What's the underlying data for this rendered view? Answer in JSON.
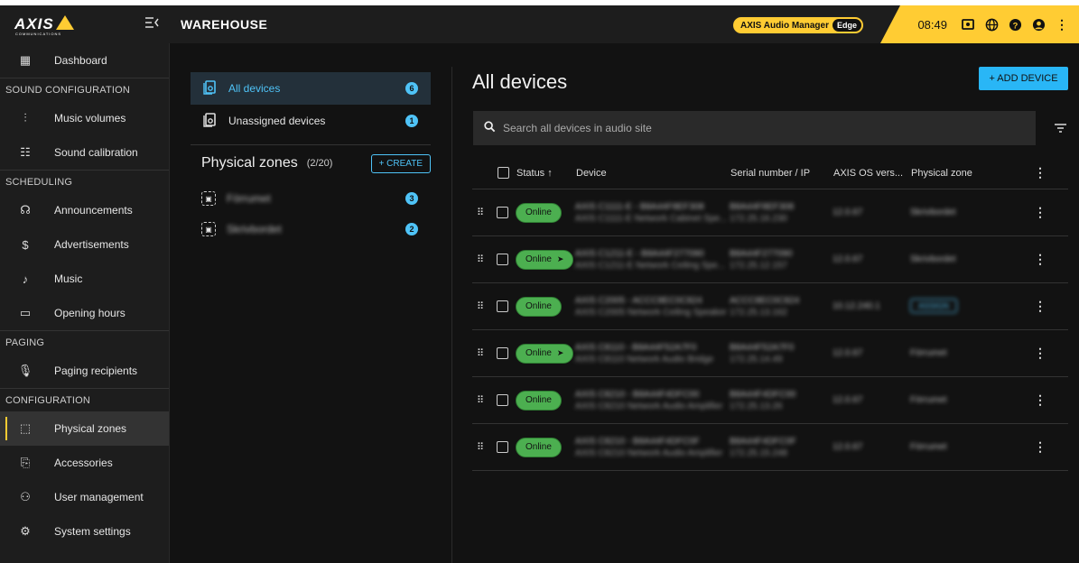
{
  "header": {
    "logo": "AXIS",
    "logo_sub": "COMMUNICATIONS",
    "site_title": "WAREHOUSE",
    "product_badge": "AXIS Audio Manager",
    "edition_badge": "Edge",
    "clock": "08:49"
  },
  "sidebar": {
    "items": [
      {
        "type": "item",
        "label": "Dashboard",
        "icon": "dashboard-icon"
      },
      {
        "type": "section",
        "label": "SOUND CONFIGURATION"
      },
      {
        "type": "item",
        "label": "Music volumes",
        "icon": "sliders-icon"
      },
      {
        "type": "item",
        "label": "Sound calibration",
        "icon": "calibration-icon"
      },
      {
        "type": "section",
        "label": "SCHEDULING"
      },
      {
        "type": "item",
        "label": "Announcements",
        "icon": "announcement-icon"
      },
      {
        "type": "item",
        "label": "Advertisements",
        "icon": "dollar-icon"
      },
      {
        "type": "item",
        "label": "Music",
        "icon": "music-note-icon"
      },
      {
        "type": "item",
        "label": "Opening hours",
        "icon": "calendar-icon"
      },
      {
        "type": "section",
        "label": "PAGING"
      },
      {
        "type": "item",
        "label": "Paging recipients",
        "icon": "microphone-icon"
      },
      {
        "type": "section",
        "label": "CONFIGURATION"
      },
      {
        "type": "item",
        "label": "Physical zones",
        "icon": "zone-icon",
        "active": true
      },
      {
        "type": "item",
        "label": "Accessories",
        "icon": "accessories-icon"
      },
      {
        "type": "item",
        "label": "User management",
        "icon": "users-icon"
      },
      {
        "type": "item",
        "label": "System settings",
        "icon": "gear-icon"
      }
    ]
  },
  "device_groups": [
    {
      "label": "All devices",
      "count": "6"
    },
    {
      "label": "Unassigned devices",
      "count": "1"
    }
  ],
  "zones": {
    "title": "Physical zones",
    "count": "(2/20)",
    "create_label": "+ CREATE",
    "items": [
      {
        "label": "Förrumet",
        "count": "3"
      },
      {
        "label": "Skrivbordet",
        "count": "2"
      }
    ]
  },
  "main": {
    "title": "All devices",
    "add_label": "+ ADD DEVICE",
    "search_placeholder": "Search all devices in audio site",
    "columns": {
      "status": "Status ↑",
      "device": "Device",
      "serial": "Serial number / IP",
      "os": "AXIS OS vers...",
      "zone": "Physical zone"
    },
    "rows": [
      {
        "status": "Online",
        "arrow": false,
        "device": "AXIS C1111-E - B8A44F8EF308",
        "model": "AXIS C1111-E Network Cabinet Spe...",
        "serial": "B8A44F8EF308",
        "ip": "172.25.16.230",
        "os": "12.0.67",
        "zone": "Skrivbordet",
        "zone_chip": false
      },
      {
        "status": "Online",
        "arrow": true,
        "device": "AXIS C1211-E - B8A44F277090",
        "model": "AXIS C1211-E Network Ceiling Spe...",
        "serial": "B8A44F277090",
        "ip": "172.25.12.157",
        "os": "12.0.67",
        "zone": "Skrivbordet",
        "zone_chip": false
      },
      {
        "status": "Online",
        "arrow": false,
        "device": "AXIS C2005 - ACCC8EC0C824",
        "model": "AXIS C2005 Network Ceiling Speaker",
        "serial": "ACCC8EC0C824",
        "ip": "172.25.13.162",
        "os": "10.12.240.1",
        "zone": "ASSIGN",
        "zone_chip": true
      },
      {
        "status": "Online",
        "arrow": true,
        "device": "AXIS C8110 - B8A44F52A7F0",
        "model": "AXIS C8110 Network Audio Bridge",
        "serial": "B8A44F52A7F0",
        "ip": "172.25.14.49",
        "os": "12.0.67",
        "zone": "Förrumet",
        "zone_chip": false
      },
      {
        "status": "Online",
        "arrow": false,
        "device": "AXIS C8210 - B8A44F4DFC00",
        "model": "AXIS C8210 Network Audio Amplifier",
        "serial": "B8A44F4DFC00",
        "ip": "172.25.13.26",
        "os": "12.0.67",
        "zone": "Förrumet",
        "zone_chip": false
      },
      {
        "status": "Online",
        "arrow": false,
        "device": "AXIS C8210 - B8A44F4DFC0F",
        "model": "AXIS C8210 Network Audio Amplifier",
        "serial": "B8A44F4DFC0F",
        "ip": "172.25.15.248",
        "os": "12.0.67",
        "zone": "Förrumet",
        "zone_chip": false
      }
    ]
  }
}
